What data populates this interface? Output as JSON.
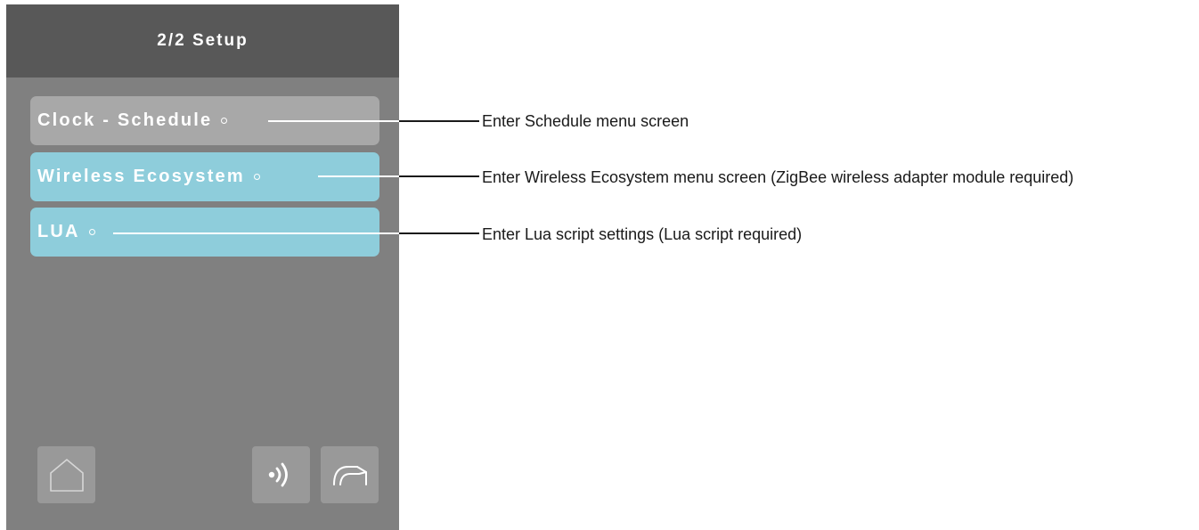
{
  "screen": {
    "title": "2/2 Setup"
  },
  "menu": {
    "items": [
      {
        "label": "Clock - Schedule",
        "style": "gray",
        "description": "Enter Schedule menu screen"
      },
      {
        "label": "Wireless Ecosystem",
        "style": "blue",
        "description": "Enter Wireless Ecosystem menu screen (ZigBee wireless adapter module required)"
      },
      {
        "label": "LUA",
        "style": "blue",
        "description": "Enter Lua script settings (Lua script required)"
      }
    ]
  },
  "footer": {
    "icons": [
      "home-icon",
      "wireless-signal-icon",
      "forward-arrow-icon"
    ]
  },
  "colors": {
    "panel_bg": "#808080",
    "header_bg": "#585858",
    "gray_button": "#a8a8a8",
    "blue_button": "#8ecddb",
    "icon_button": "#999999"
  }
}
